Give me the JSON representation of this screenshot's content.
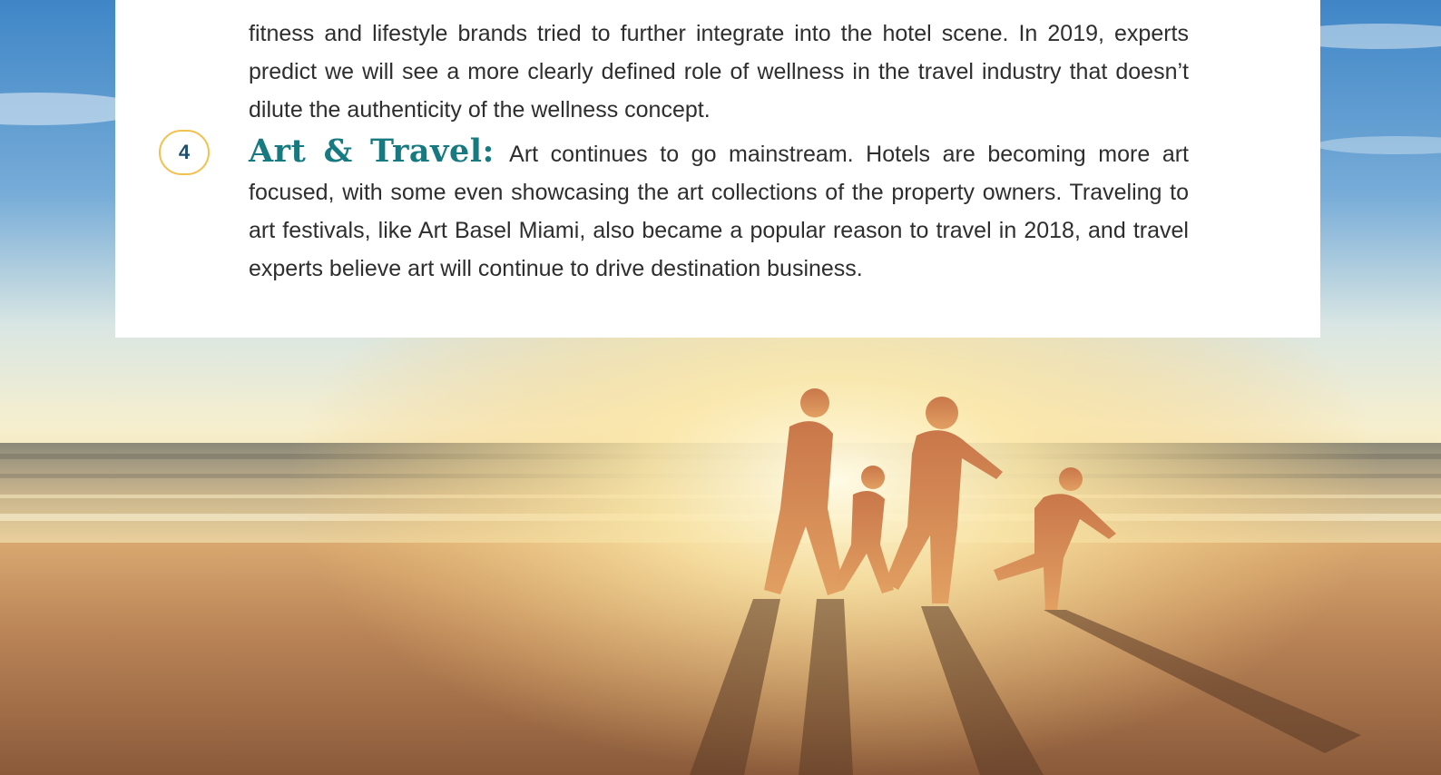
{
  "article": {
    "previous_paragraph_tail": "fitness and lifestyle brands tried to further integrate into the hotel scene. In 2019, experts predict we will see a more clearly defined role of wellness in the travel industry that doesn’t dilute the authenticity of the wellness concept.",
    "items": [
      {
        "number": "4",
        "heading": "Art & Travel:",
        "body": "Art continues to go mainstream. Hotels are becoming more art focused, with some even showcasing the art collections of the property owners. Travel­ing to art festivals, like Art Basel Miami, also became a popular reason to travel in 2018, and travel experts believe art will continue to drive destination business."
      }
    ]
  },
  "colors": {
    "heading": "#177a80",
    "badge_border": "#f2c14e",
    "badge_text": "#1f4f6e",
    "body_text": "#2e2e2e"
  },
  "image": {
    "subject": "family-running-on-beach-at-sunset-photo"
  }
}
